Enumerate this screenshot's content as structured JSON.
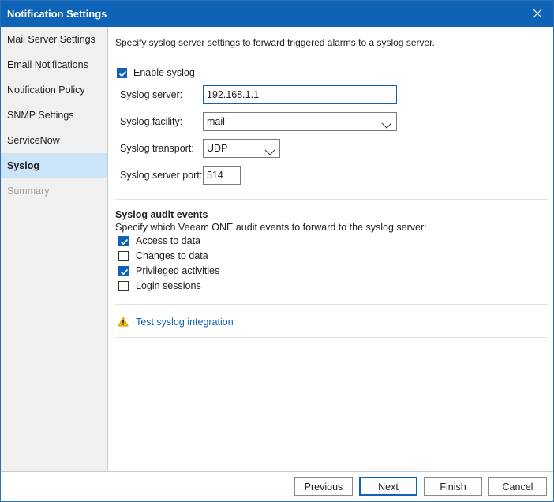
{
  "window": {
    "title": "Notification Settings"
  },
  "sidebar": {
    "items": [
      {
        "label": "Mail Server Settings"
      },
      {
        "label": "Email Notifications"
      },
      {
        "label": "Notification Policy"
      },
      {
        "label": "SNMP Settings"
      },
      {
        "label": "ServiceNow"
      },
      {
        "label": "Syslog",
        "active": true
      },
      {
        "label": "Summary",
        "disabled": true
      }
    ]
  },
  "main": {
    "description": "Specify syslog server settings to forward triggered alarms to a syslog server.",
    "enable_syslog": {
      "label": "Enable syslog",
      "checked": true
    },
    "syslog_server": {
      "label": "Syslog server:",
      "value": "192.168.1.1"
    },
    "syslog_facility": {
      "label": "Syslog facility:",
      "value": "mail"
    },
    "syslog_transport": {
      "label": "Syslog transport:",
      "value": "UDP"
    },
    "syslog_port": {
      "label": "Syslog server port:",
      "value": "514"
    },
    "audit": {
      "title": "Syslog audit events",
      "description": "Specify which Veeam ONE audit events to forward to the syslog server:",
      "events": [
        {
          "label": "Access to data",
          "checked": true
        },
        {
          "label": "Changes to data",
          "checked": false
        },
        {
          "label": "Privileged activities",
          "checked": true
        },
        {
          "label": "Login sessions",
          "checked": false
        }
      ]
    },
    "test_link": "Test syslog integration"
  },
  "footer": {
    "previous": "Previous",
    "next": "Next",
    "finish": "Finish",
    "cancel": "Cancel"
  },
  "colors": {
    "accent": "#0f63b6",
    "selected_nav": "#cce4f7",
    "warning": "#f2b705"
  },
  "icons": {
    "close": "close-icon",
    "warning": "warning-icon",
    "check": "check-icon",
    "dropdown": "chevron-down-icon"
  }
}
